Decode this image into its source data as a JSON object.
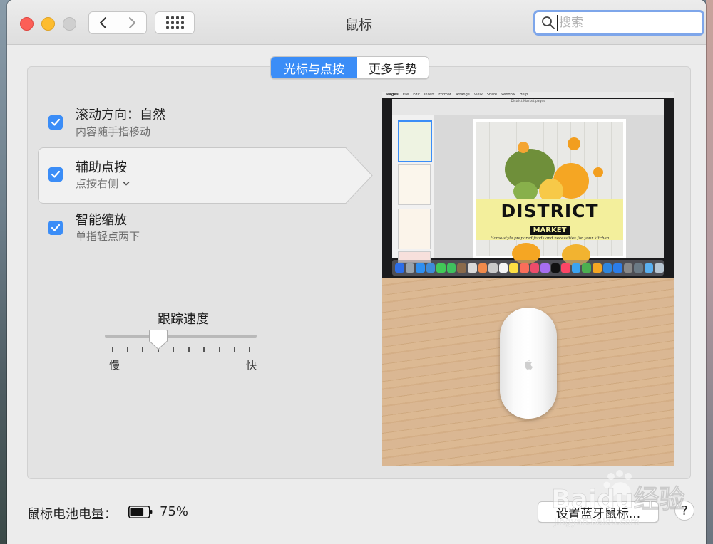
{
  "window": {
    "title": "鼠标"
  },
  "search": {
    "placeholder": "搜索"
  },
  "tabs": [
    {
      "label": "光标与点按",
      "active": true
    },
    {
      "label": "更多手势",
      "active": false
    }
  ],
  "options": [
    {
      "title": "滚动方向：自然",
      "subtitle": "内容随手指移动",
      "checked": true
    },
    {
      "title": "辅助点按",
      "subtitle": "点按右侧",
      "checked": true,
      "has_dropdown": true
    },
    {
      "title": "智能缩放",
      "subtitle": "单指轻点两下",
      "checked": true
    }
  ],
  "tracking": {
    "title": "跟踪速度",
    "slow_label": "慢",
    "fast_label": "快",
    "level": 0.33
  },
  "preview": {
    "app_name": "Pages",
    "menu_items": [
      "Pages",
      "File",
      "Edit",
      "Insert",
      "Format",
      "Arrange",
      "View",
      "Share",
      "Window",
      "Help"
    ],
    "doc_title": "District Market.pages",
    "brand_main": "DISTRICT",
    "brand_sub": "MARKET",
    "tagline": "Home-style prepared foods and necessities for your kitchen"
  },
  "battery": {
    "label": "鼠标电池电量：",
    "percent": "75%",
    "level": 0.75
  },
  "footer": {
    "setup_label": "设置蓝牙鼠标...",
    "help_label": "?"
  },
  "watermark": {
    "brand": "Baidu经验",
    "url": "jingyan.baidu.com"
  },
  "colors": {
    "accent": "#3b8df7",
    "close": "#fc5f57",
    "minimize": "#fdbc2e",
    "banner": "#f3ef9c"
  }
}
